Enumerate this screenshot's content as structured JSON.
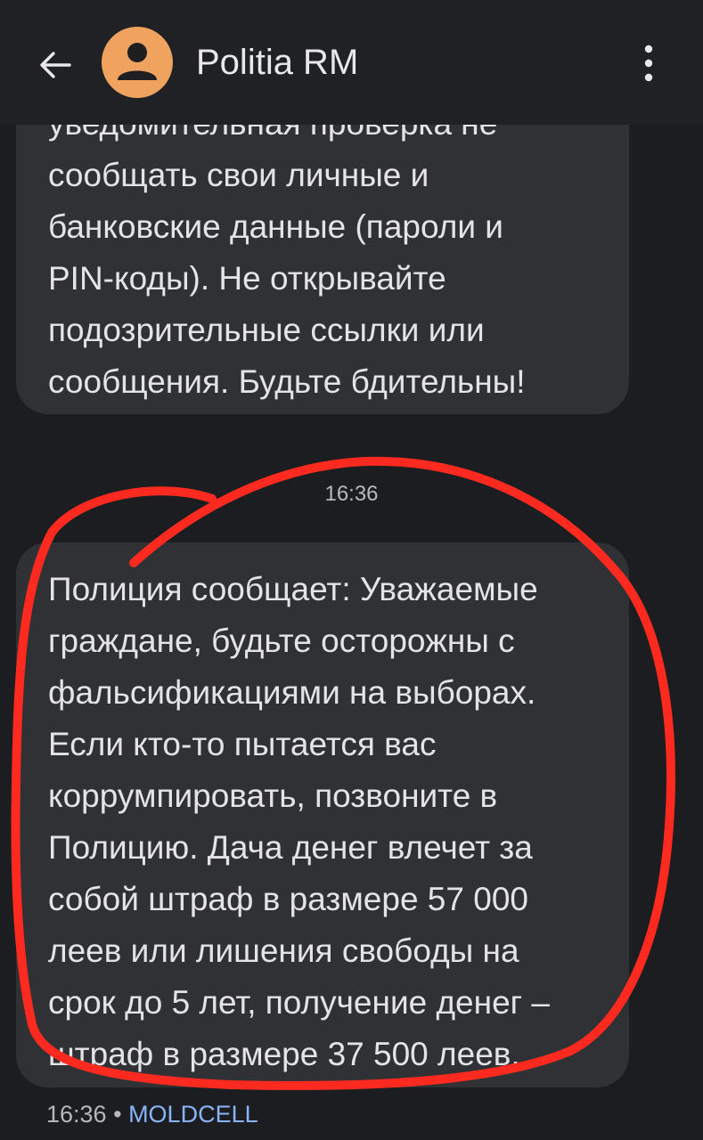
{
  "header": {
    "contact_name": "Politia RM",
    "back_icon": "arrow-left-icon",
    "avatar_icon": "person-icon",
    "more_icon": "more-vert-icon",
    "avatar_color": "#f0a35e"
  },
  "messages": [
    {
      "lines": [
        "уведомительная проверка не",
        "сообщать свои личные и",
        "банковские данные (пароли и",
        "PIN-коды). Не открывайте",
        "подозрительные ссылки или",
        "сообщения. Будьте бдительны!"
      ]
    },
    {
      "lines": [
        "Полиция сообщает: Уважаемые",
        "граждане, будьте осторожны с",
        "фальсификациями на выборах.",
        "Если кто-то пытается вас",
        "коррумпировать, позвоните в",
        "Полицию. Дача денег влечет за",
        "собой штраф в размере 57 000",
        "леев или лишения свободы на",
        "срок до 5 лет, получение денег –",
        "штраф в размере 37 500 леев."
      ]
    }
  ],
  "time_separator": "16:36",
  "footer": {
    "time": "16:36",
    "dot": "•",
    "carrier": "MOLDCELL"
  },
  "colors": {
    "background": "#1c1d21",
    "bubble": "#303135",
    "annotation": "#ff2a1f",
    "carrier_link": "#8ab4f8"
  }
}
